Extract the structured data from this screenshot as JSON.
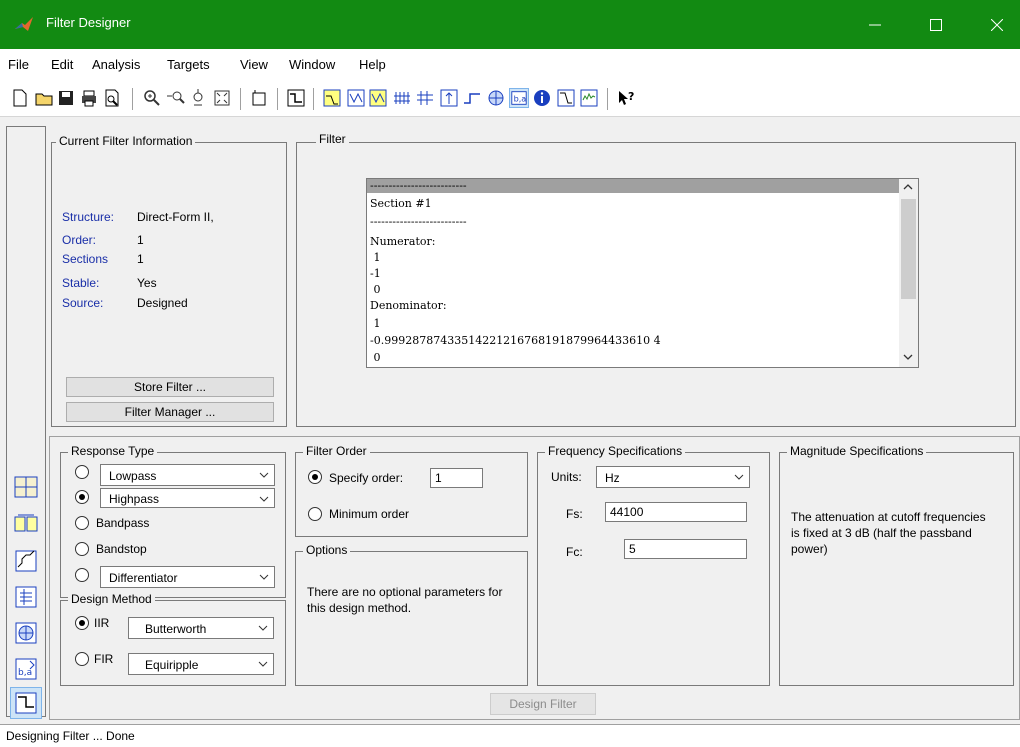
{
  "window": {
    "title": "Filter Designer"
  },
  "menu": [
    "File",
    "Edit",
    "Analysis",
    "Targets",
    "View",
    "Window",
    "Help"
  ],
  "current_filter": {
    "group_title": "Current Filter Information",
    "rows": [
      {
        "label": "Structure:",
        "value": "Direct-Form II,"
      },
      {
        "label": "Order:",
        "value": "1"
      },
      {
        "label": "Sections",
        "value": "1"
      },
      {
        "label": "Stable:",
        "value": "Yes"
      },
      {
        "label": "Source:",
        "value": "Designed"
      }
    ],
    "store_button": "Store Filter ...",
    "manager_button": "Filter Manager ..."
  },
  "filter_panel": {
    "title": "Filter",
    "lines": [
      "--------------------------",
      "Section #1",
      "--------------------------",
      "Numerator:",
      " 1",
      "-1",
      " 0",
      "Denominator:",
      " 1",
      "-0.99928787433514221216768191879964433610 4",
      " 0"
    ]
  },
  "response_type": {
    "title": "Response Type",
    "options": [
      "Lowpass",
      "Highpass",
      "Bandpass",
      "Bandstop",
      "Differentiator"
    ]
  },
  "design_method": {
    "title": "Design Method",
    "iir_label": "IIR",
    "iir_value": "Butterworth",
    "fir_label": "FIR",
    "fir_value": "Equiripple"
  },
  "filter_order": {
    "title": "Filter Order",
    "specify_label": "Specify order:",
    "specify_value": "1",
    "minimum_label": "Minimum order"
  },
  "options": {
    "title": "Options",
    "text": "There are no optional parameters for this design method."
  },
  "frequency": {
    "title": "Frequency Specifications",
    "units_label": "Units:",
    "units_value": "Hz",
    "fs_label": "Fs:",
    "fs_value": "44100",
    "fc_label": "Fc:",
    "fc_value": "5"
  },
  "magnitude": {
    "title": "Magnitude Specifications",
    "text": "The attenuation at cutoff frequencies is fixed at 3 dB (half the passband power)"
  },
  "design_button": "Design Filter",
  "status": "Designing Filter ... Done"
}
